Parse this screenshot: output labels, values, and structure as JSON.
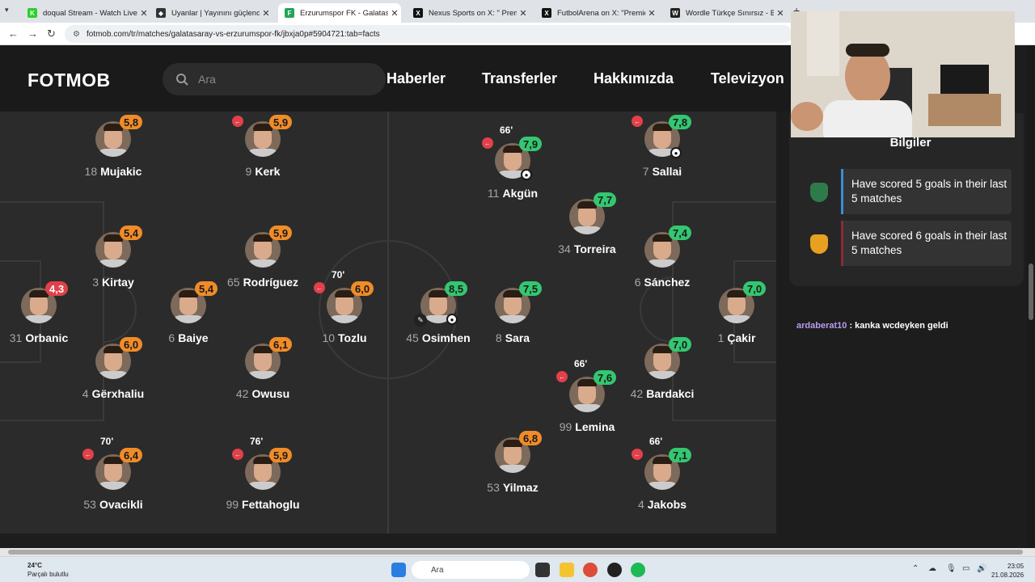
{
  "browser": {
    "tabs": [
      {
        "title": "doqual Stream - Watch Live on",
        "favicon": "kick-icon",
        "color": "#2bd12b",
        "glyph": "K"
      },
      {
        "title": "Uyanlar | Yayınını güçlendirmek",
        "favicon": "shield-icon",
        "color": "#333333",
        "glyph": "◆"
      },
      {
        "title": "Erzurumspor FK - Galatasaray c",
        "favicon": "fotmob-icon",
        "color": "#23a55a",
        "glyph": "F",
        "active": true
      },
      {
        "title": "Nexus Sports on X: \" Premie",
        "favicon": "x-icon",
        "color": "#111111",
        "glyph": "X"
      },
      {
        "title": "FutbolArena on X: \"Premier Lig",
        "favicon": "x-icon",
        "color": "#111111",
        "glyph": "X"
      },
      {
        "title": "Wordle Türkçe Sınırsız - Bekler",
        "favicon": "wordle-icon",
        "color": "#222222",
        "glyph": "W"
      }
    ],
    "url": "fotmob.com/tr/matches/galatasaray-vs-erzurumspor-fk/jbxja0p#5904721:tab=facts"
  },
  "header": {
    "logo": "FOTMOB",
    "search_placeholder": "Ara",
    "menu": [
      "Haberler",
      "Transferler",
      "Hakkımızda",
      "Televizyon"
    ]
  },
  "players": [
    {
      "num": "18",
      "name": "Mujakic",
      "rating": "5,8",
      "color": "#f08c28"
    },
    {
      "num": "9",
      "name": "Kerk",
      "rating": "5,9",
      "color": "#f08c28",
      "sub": true
    },
    {
      "num": "11",
      "name": "Akgün",
      "rating": "7,9",
      "color": "#33c771",
      "sub": true,
      "minute": "66'",
      "goal": true
    },
    {
      "num": "7",
      "name": "Sallai",
      "rating": "7,8",
      "color": "#33c771",
      "sub": true,
      "goal": true
    },
    {
      "num": "34",
      "name": "Torreira",
      "rating": "7,7",
      "color": "#33c771"
    },
    {
      "num": "3",
      "name": "Kirtay",
      "rating": "5,4",
      "color": "#f08c28"
    },
    {
      "num": "65",
      "name": "Rodríguez",
      "rating": "5,9",
      "color": "#f08c28"
    },
    {
      "num": "6",
      "name": "Sánchez",
      "rating": "7,4",
      "color": "#33c771"
    },
    {
      "num": "31",
      "name": "Orbanic",
      "rating": "4,3",
      "color": "#e2404a"
    },
    {
      "num": "6",
      "name": "Baiye",
      "rating": "5,4",
      "color": "#f08c28"
    },
    {
      "num": "10",
      "name": "Tozlu",
      "rating": "6,0",
      "color": "#f08c28",
      "sub": true,
      "minute": "70'"
    },
    {
      "num": "45",
      "name": "Osimhen",
      "rating": "8,5",
      "color": "#33c771",
      "goal": true,
      "assist": true
    },
    {
      "num": "8",
      "name": "Sara",
      "rating": "7,5",
      "color": "#33c771"
    },
    {
      "num": "1",
      "name": "Çakir",
      "rating": "7,0",
      "color": "#33c771"
    },
    {
      "num": "4",
      "name": "Gërxhaliu",
      "rating": "6,0",
      "color": "#f08c28"
    },
    {
      "num": "42",
      "name": "Owusu",
      "rating": "6,1",
      "color": "#f08c28"
    },
    {
      "num": "42",
      "name": "Bardakci",
      "rating": "7,0",
      "color": "#33c771"
    },
    {
      "num": "99",
      "name": "Lemina",
      "rating": "7,6",
      "color": "#33c771",
      "sub": true,
      "minute": "66'"
    },
    {
      "num": "53",
      "name": "Ovacikli",
      "rating": "6,4",
      "color": "#f08c28",
      "sub": true,
      "minute": "70'"
    },
    {
      "num": "99",
      "name": "Fettahoglu",
      "rating": "5,9",
      "color": "#f08c28",
      "sub": true,
      "minute": "76'"
    },
    {
      "num": "53",
      "name": "Yilmaz",
      "rating": "6,8",
      "color": "#f08c28"
    },
    {
      "num": "4",
      "name": "Jakobs",
      "rating": "7,1",
      "color": "#33c771",
      "sub": true,
      "minute": "66'"
    }
  ],
  "facts": {
    "title": "Bilgiler",
    "items": [
      {
        "text": "Have scored 5 goals in their last 5 matches",
        "bar": "#3a8fd4",
        "crest": "#2f7a4a"
      },
      {
        "text": "Have scored 6 goals in their last 5 matches",
        "bar": "#8b2b3a",
        "crest": "#e8a020"
      }
    ]
  },
  "chat": {
    "user": "ardaberat10",
    "message": ": kanka wcdeyken geldi"
  },
  "taskbar": {
    "temp": "24°C",
    "weather": "Parçalı bulutlu",
    "search": "Ara",
    "time": "23:05",
    "date": "21.08.2026"
  }
}
